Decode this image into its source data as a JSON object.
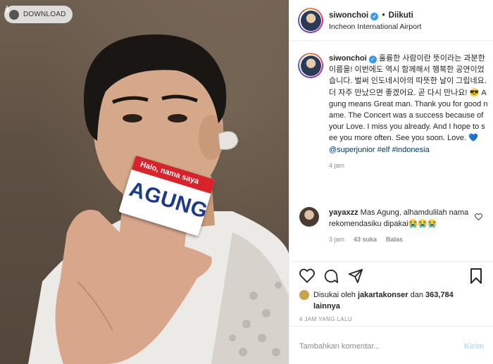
{
  "photo": {
    "download_label": "DOWNLOAD",
    "card_band_text": "Halo, nama saya",
    "card_name": "AGUNG"
  },
  "header": {
    "username": "siwonchoi",
    "separator": "•",
    "follow_status": "Diikuti",
    "location": "Incheon International Airport"
  },
  "caption": {
    "username": "siwonchoi",
    "text_korean": "훌륭한 사람이란 뜻이라는 과분한 이름을! 이번에도 역시 함께해서 행복한 공연이었습니다. 벌써 인도네시아의 따뜻한 날이 그립네요. 더 자주 만났으면 좋겠어요. 곧 다시 만나요!",
    "emoji_sunglasses": "😎",
    "text_english": "Agung means Great man. Thank you for good name. The Concert was a success because of your Love. I miss you already. And I hope to see you more often. See you soon. Love.",
    "emoji_heart": "💙",
    "mention": "@superjunior",
    "hashtag1": "#elf",
    "hashtag2": "#indonesia",
    "time": "4 jam"
  },
  "reply": {
    "username": "yayaxzz",
    "text": "Mas Agung, alhamdulilah nama rekomendasiku dipakai",
    "emojis": "😭😭😭",
    "time": "3 jam",
    "likes": "43 suka",
    "reply_label": "Balas"
  },
  "likes": {
    "prefix": "Disukai oleh",
    "user": "jakartakonser",
    "joiner": "dan",
    "count": "363,784",
    "suffix": "lainnya"
  },
  "post_time": "4 JAM YANG LALU",
  "comment_input": {
    "placeholder": "Tambahkan komentar...",
    "send_label": "Kirim"
  },
  "colors": {
    "link": "#003569",
    "verified": "#3897f0",
    "muted": "#8e8e8e",
    "send_disabled": "#b2dffc"
  }
}
